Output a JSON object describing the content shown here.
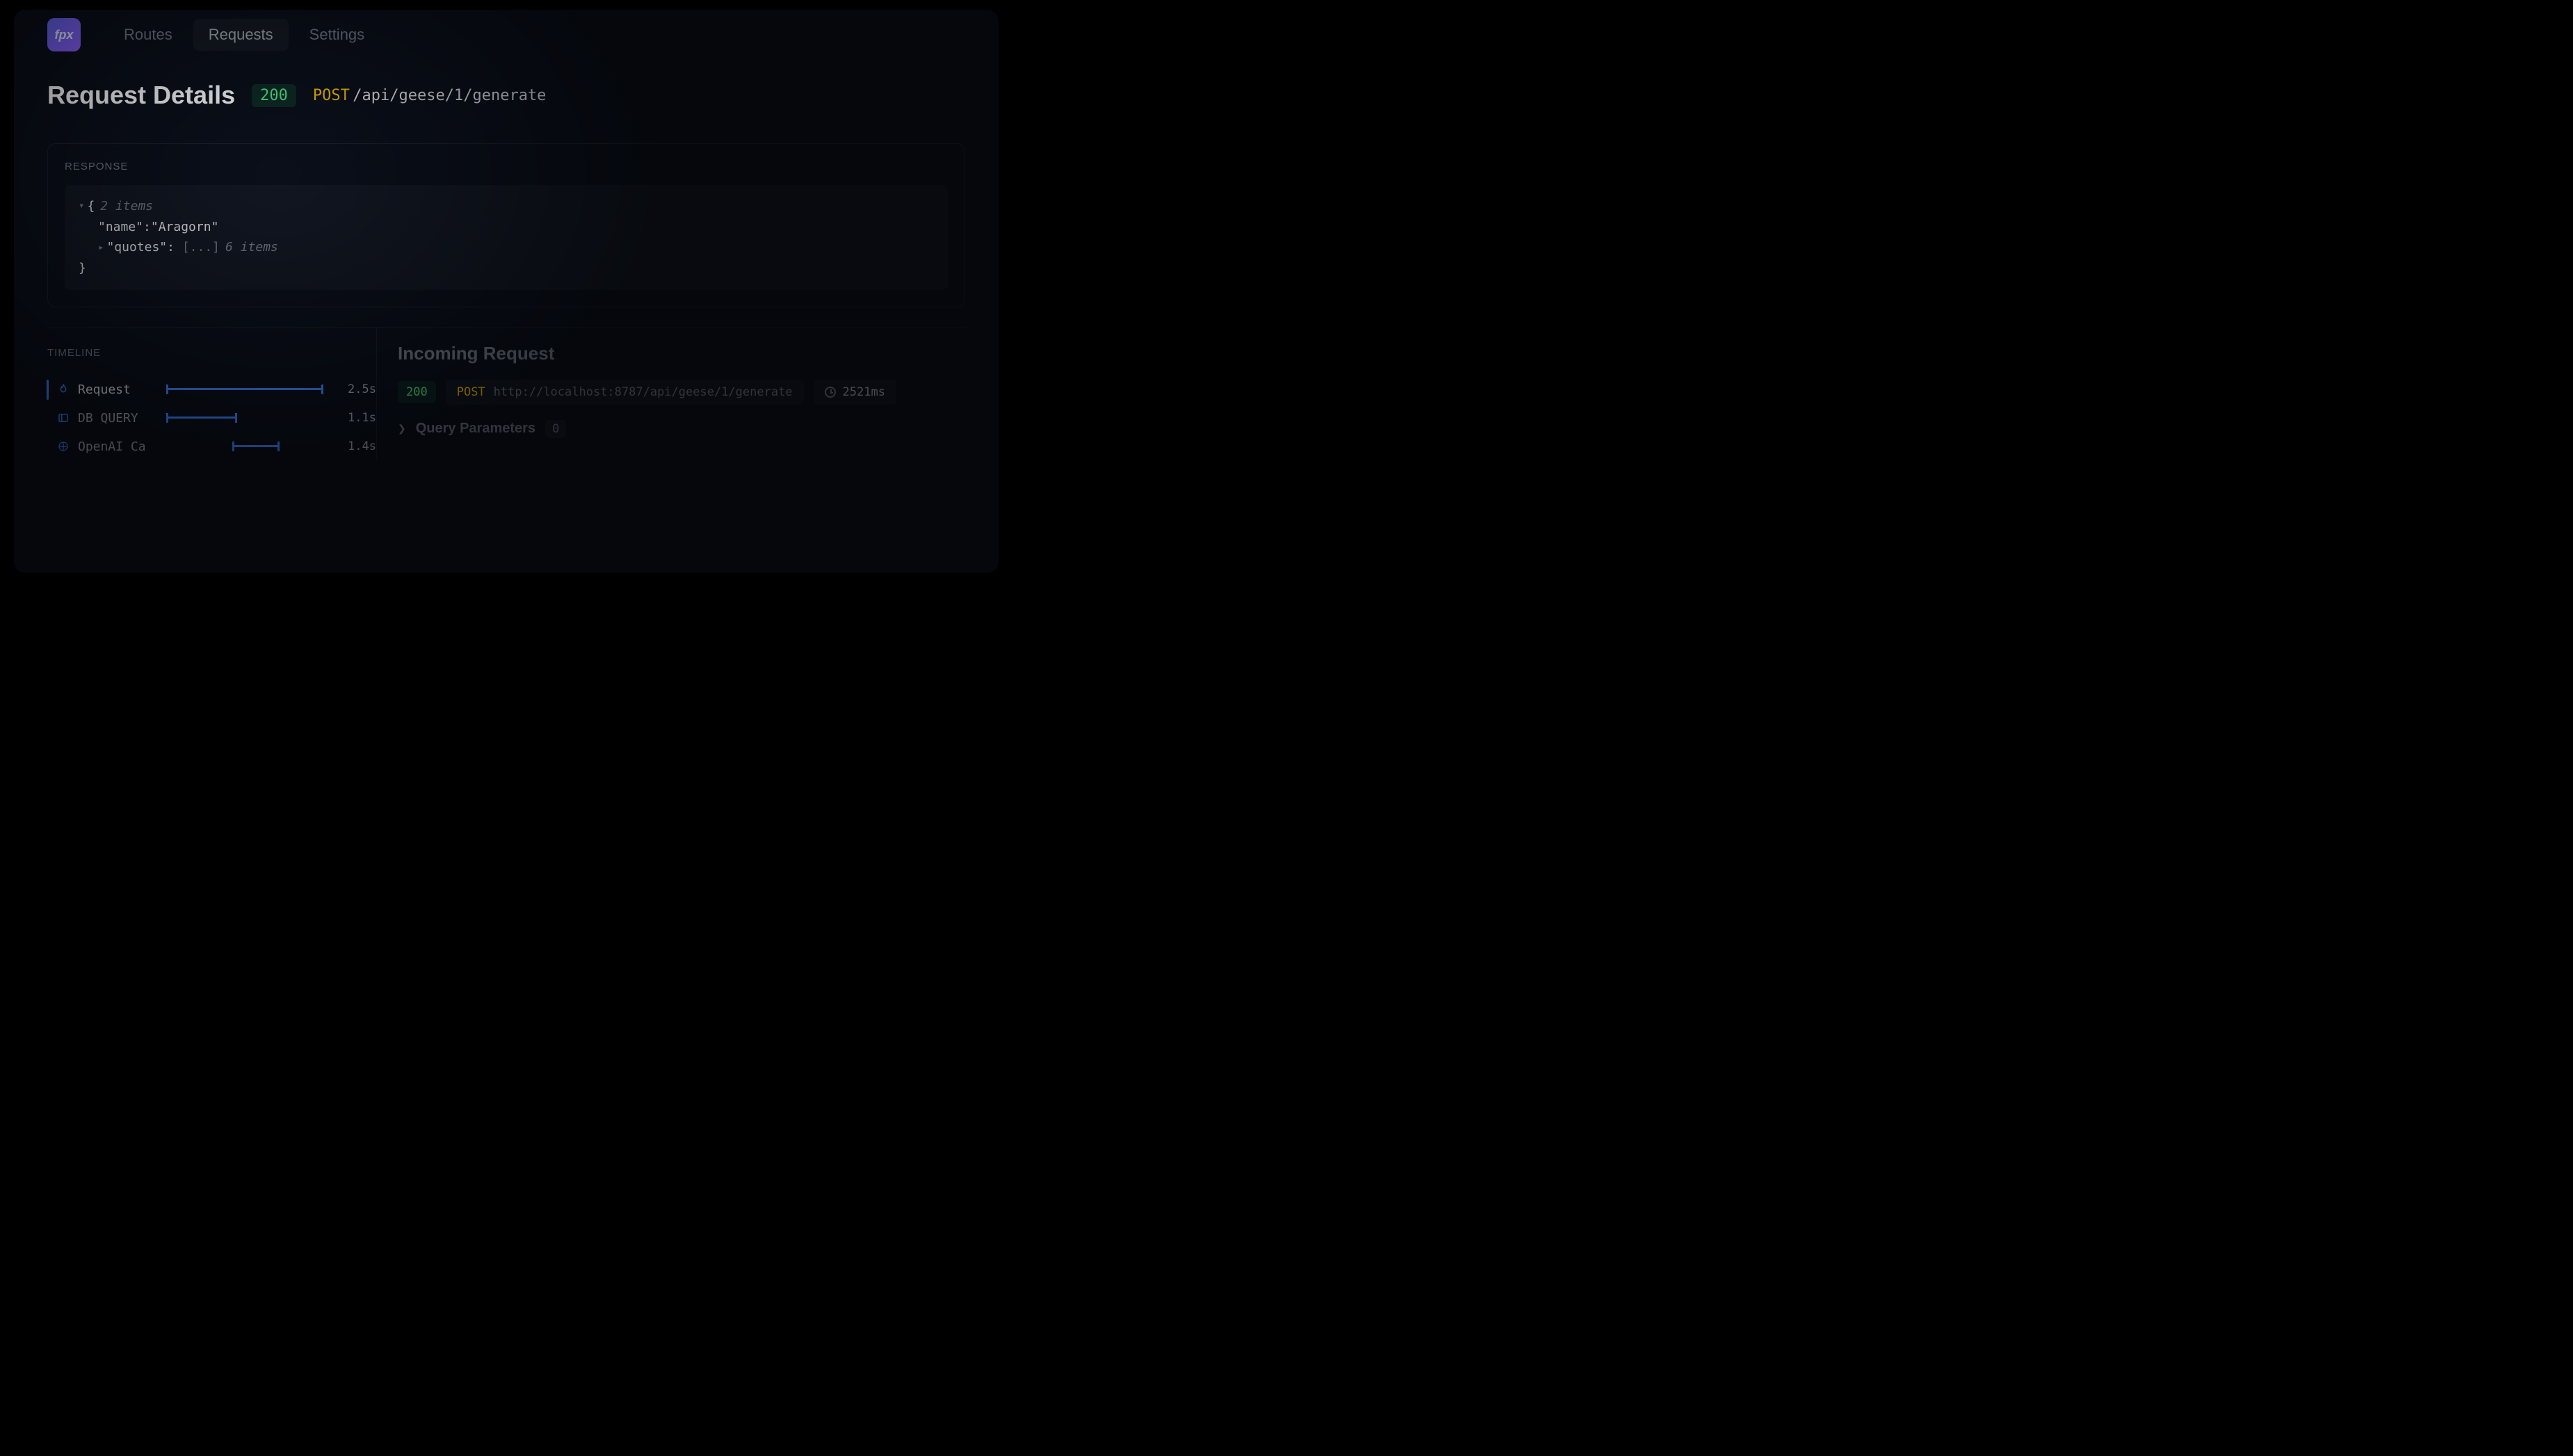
{
  "brand": "fpx",
  "nav": {
    "items": [
      "Routes",
      "Requests",
      "Settings"
    ],
    "activeIndex": 1
  },
  "header": {
    "title": "Request Details",
    "status": "200",
    "method": "POST",
    "path": "/api/geese/1/generate"
  },
  "response": {
    "label": "RESPONSE",
    "itemsMeta": "2 items",
    "nameKey": "\"name\"",
    "nameVal": "\"Aragorn\"",
    "quotesKey": "\"quotes\"",
    "quotesCollapsed": "[...]",
    "quotesMeta": "6 items"
  },
  "timeline": {
    "title": "TIMELINE",
    "rows": [
      {
        "icon": "flame",
        "name": "Request",
        "barLeft": 0,
        "barWidth": 100,
        "duration": "2.5s",
        "active": true
      },
      {
        "icon": "db",
        "name": "DB QUERY",
        "barLeft": 0,
        "barWidth": 45,
        "duration": "1.1s",
        "active": false
      },
      {
        "icon": "openai",
        "name": "OpenAI Ca",
        "barLeft": 42,
        "barWidth": 30,
        "duration": "1.4s",
        "active": false
      }
    ]
  },
  "incoming": {
    "title": "Incoming Request",
    "status": "200",
    "method": "POST",
    "url": "http://localhost:8787/api/geese/1/generate",
    "durationMs": "2521ms",
    "queryParams": {
      "label": "Query Parameters",
      "count": "0"
    }
  }
}
